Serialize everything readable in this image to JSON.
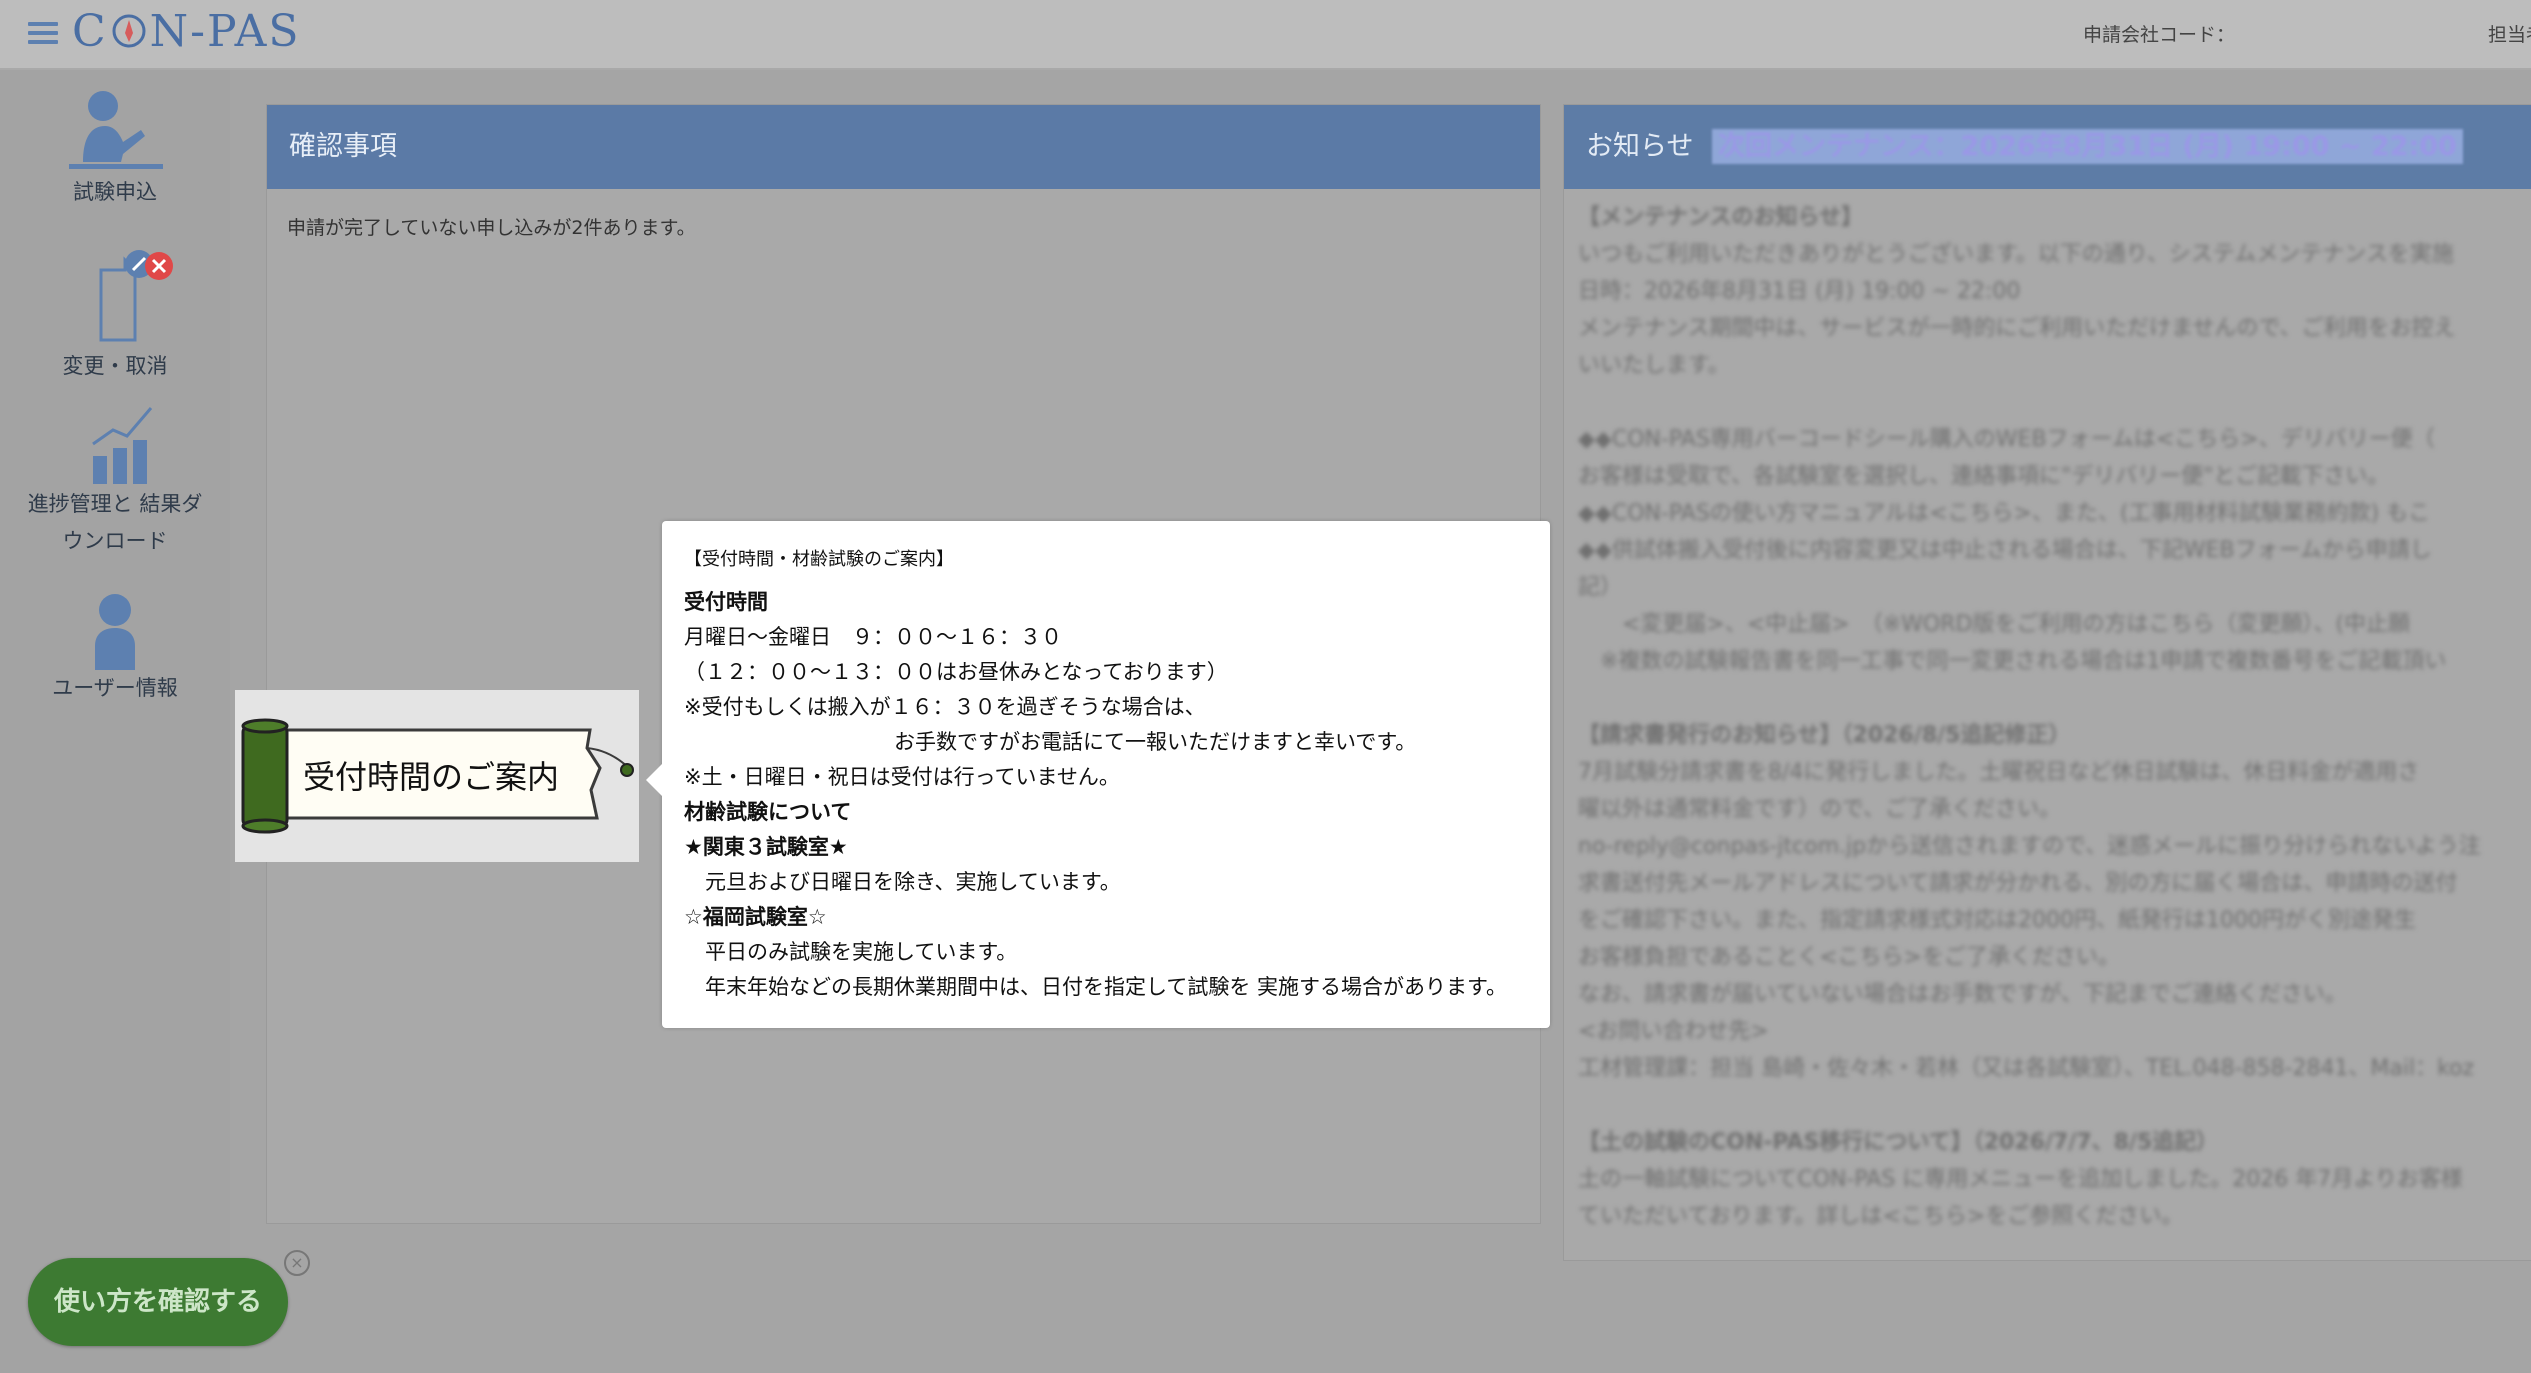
{
  "header": {
    "logo": "CON-PAS",
    "company_code_label": "申請会社コード：",
    "tantou_label": "担当者"
  },
  "sidebar": {
    "items": [
      {
        "label": "試験申込",
        "icon": "person-presenting-icon"
      },
      {
        "label": "変更・取消",
        "icon": "document-edit-cancel-icon"
      },
      {
        "label_line1": "進捗管理と 結果ダ",
        "label_line2": "ウンロード",
        "icon": "bar-chart-icon"
      },
      {
        "label": "ユーザー情報",
        "icon": "user-icon"
      }
    ]
  },
  "confirm": {
    "title": "確認事項",
    "message": "申請が完了していない申し込みが2件あります。"
  },
  "notice": {
    "title": "お知らせ",
    "maintenance_headline": "次回メンテナンス：2026年8月31日 (月) 19:00 ~ 22:00",
    "lines": [
      "【メンテナンスのお知らせ】",
      "いつもご利用いただきありがとうございます。以下の通り、システムメンテナンスを実施",
      "日時：2026年8月31日 (月) 19:00 ~ 22:00",
      "メンテナンス期間中は、サービスが一時的にご利用いただけませんので、ご利用をお控え",
      "いいたします。",
      "",
      "◆◆CON-PAS専用バーコードシール購入のWEBフォームは<こちら>、デリバリー便（",
      "お客様は受取で、各試験室を選択し、連絡事項に\"デリバリー便\"とご記載下さい。",
      "◆◆CON-PASの使い方マニュアルは<こちら>、また、(工事用材料試験業務約款) もこ",
      "◆◆供試体搬入受付後に内容変更又は中止される場合は、下記WEBフォームから申請し",
      "記）",
      "　　<変更届>、<中止届>　（※WORD版をご利用の方はこちら（変更願）、(中止願",
      "　※複数の試験報告書を同一工事で同一変更される場合は1申請で複数番号をご記載頂い",
      "",
      "【請求書発行のお知らせ】（2026/8/5追記修正）",
      "7月試験分請求書を8/4に発行しました。土曜祝日など休日試験は、休日料金が適用さ",
      "曜以外は通常料金です）ので、ご了承ください。",
      "no-reply@conpas-jtcom.jpから送信されますので、迷惑メールに振り分けられないよう注",
      "求書送付先メールアドレスについて請求が分かれる、別の方に届く場合は、申請時の送付",
      "をご確認下さい。また、指定請求様式対応は2000円、紙発行は1000円がく別途発生",
      "お客様負担であることく<こちら>をご了承ください。",
      "なお、請求書が届いていない場合はお手数ですが、下記までご連絡ください。",
      "<お問い合わせ先>",
      "工材管理課：担当 島崎・佐々木・若林（又は各試験室）、TEL.048-858-2841、Mail：koz",
      "",
      "【土の試験のCON-PAS移行について】（2026/7/7、8/5追記）",
      "土の一軸試験についてCON-PAS に専用メニューを追加しました。2026 年7月よりお客様",
      "ていただいております。詳しは<こちら>をご参照ください。"
    ]
  },
  "banner": {
    "text": "受付時間のご案内"
  },
  "tooltip": {
    "title": "【受付時間・材齢試験のご案内】",
    "lines": [
      {
        "text": "受付時間",
        "bold": true
      },
      {
        "text": "月曜日〜金曜日　９：００〜１６：３０",
        "bold": false
      },
      {
        "text": "（１２：００〜１３：００はお昼休みとなっております）",
        "bold": false
      },
      {
        "text": "※受付もしくは搬入が１６：３０を過ぎそうな場合は、",
        "bold": false
      },
      {
        "text": "　　　　　　　　　　お手数ですがお電話にて一報いただけますと幸いです。",
        "bold": false
      },
      {
        "text": "※土・日曜日・祝日は受付は行っていません。",
        "bold": false
      },
      {
        "text": "材齢試験について",
        "bold": true
      },
      {
        "text": "★関東３試験室★",
        "bold": true
      },
      {
        "text": "　元旦および日曜日を除き、実施しています。",
        "bold": false
      },
      {
        "text": "☆福岡試験室☆",
        "bold": true
      },
      {
        "text": "　平日のみ試験を実施しています。",
        "bold": false
      },
      {
        "text": "　年末年始などの長期休業期間中は、日付を指定して試験を 実施する場合があります。",
        "bold": false
      }
    ]
  },
  "howto": {
    "label": "使い方を確認する",
    "close": "×"
  },
  "colors": {
    "accent": "#5b7aa6",
    "howto_bg": "#3d7a32",
    "banner_roll": "#3f6a1f"
  }
}
